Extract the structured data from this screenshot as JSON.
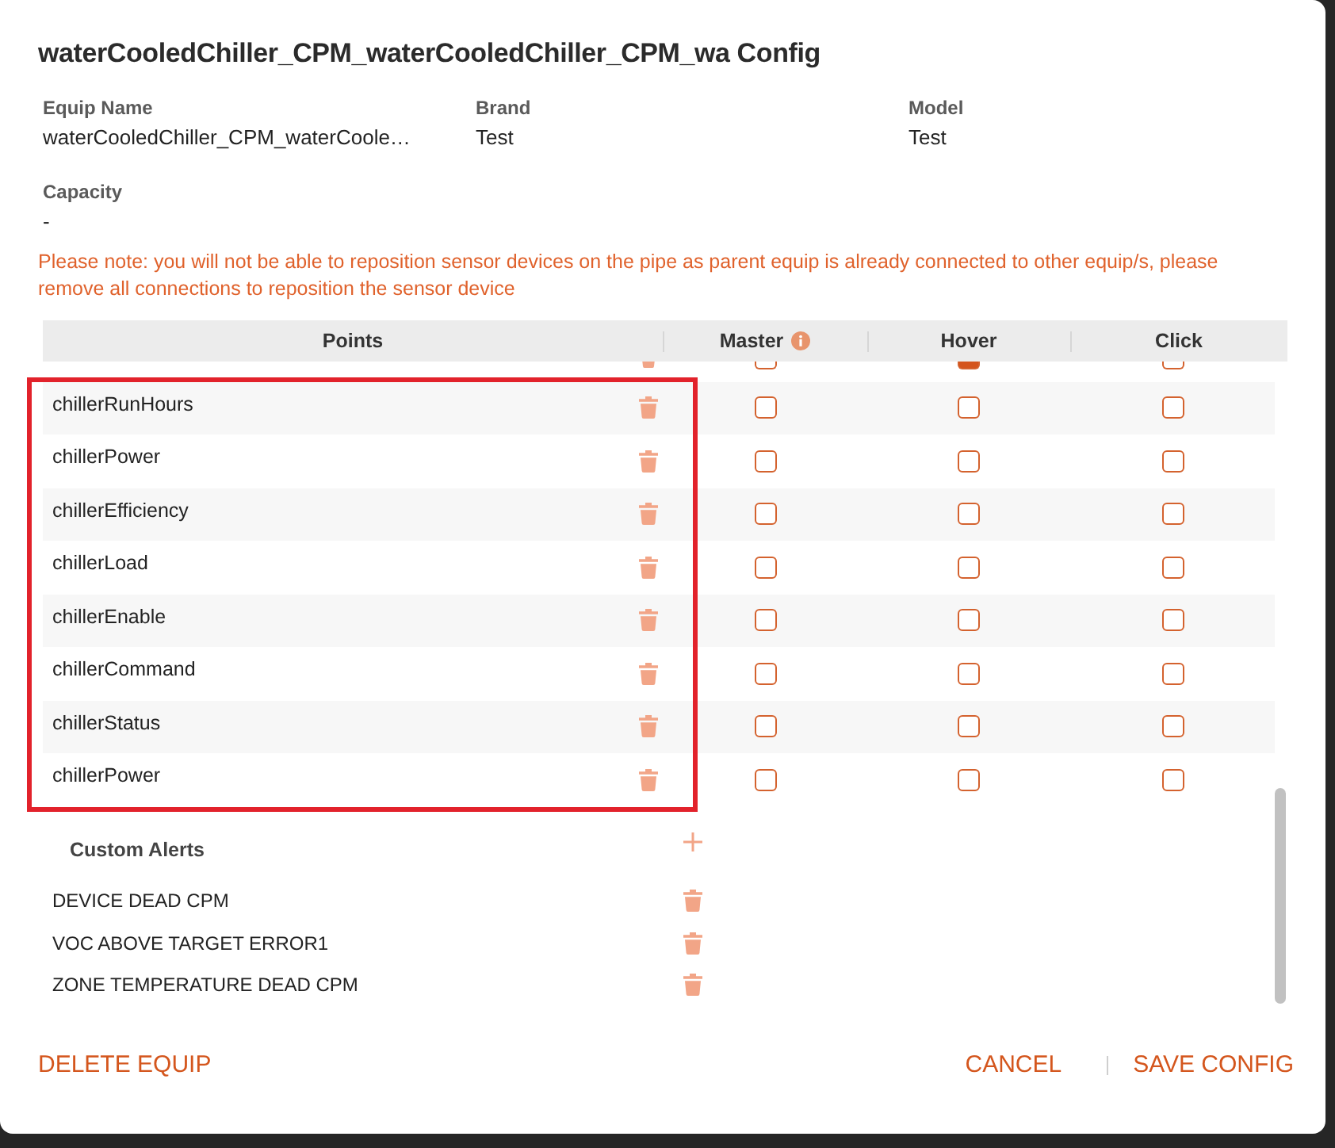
{
  "dialog": {
    "title": "waterCooledChiller_CPM_waterCooledChiller_CPM_wa Config"
  },
  "details": [
    {
      "label": "Equip Name",
      "value": "waterCooledChiller_CPM_waterCoole…"
    },
    {
      "label": "Brand",
      "value": "Test"
    },
    {
      "label": "Model",
      "value": "Test"
    },
    {
      "label": "Capacity",
      "value": "-"
    }
  ],
  "note": "Please note: you will not be able to reposition sensor devices on the pipe as parent equip is already connected to other equip/s, please remove all connections to reposition the sensor device",
  "points_table": {
    "columns": [
      {
        "label": "Points",
        "info": false
      },
      {
        "label": "Master",
        "info": true
      },
      {
        "label": "Hover",
        "info": false
      },
      {
        "label": "Click",
        "info": false
      }
    ],
    "rows": [
      {
        "master": false,
        "hover": true,
        "click": false
      },
      {
        "name": "chillerRunHours",
        "master": false,
        "hover": false,
        "click": false
      },
      {
        "name": "chillerPower",
        "master": false,
        "hover": false,
        "click": false
      },
      {
        "name": "chillerEfficiency",
        "master": false,
        "hover": false,
        "click": false
      },
      {
        "name": "chillerLoad",
        "master": false,
        "hover": false,
        "click": false
      },
      {
        "name": "chillerEnable",
        "master": false,
        "hover": false,
        "click": false
      },
      {
        "name": "chillerCommand",
        "master": false,
        "hover": false,
        "click": false
      },
      {
        "name": "chillerStatus",
        "master": false,
        "hover": false,
        "click": false
      },
      {
        "name": "chillerPower",
        "master": false,
        "hover": false,
        "click": false
      }
    ]
  },
  "custom_alerts": {
    "title": "Custom Alerts",
    "items": [
      "DEVICE DEAD CPM",
      "VOC ABOVE TARGET ERROR1",
      "ZONE TEMPERATURE DEAD CPM"
    ]
  },
  "footer": {
    "delete": "DELETE EQUIP",
    "cancel": "CANCEL",
    "save": "SAVE CONFIG"
  }
}
